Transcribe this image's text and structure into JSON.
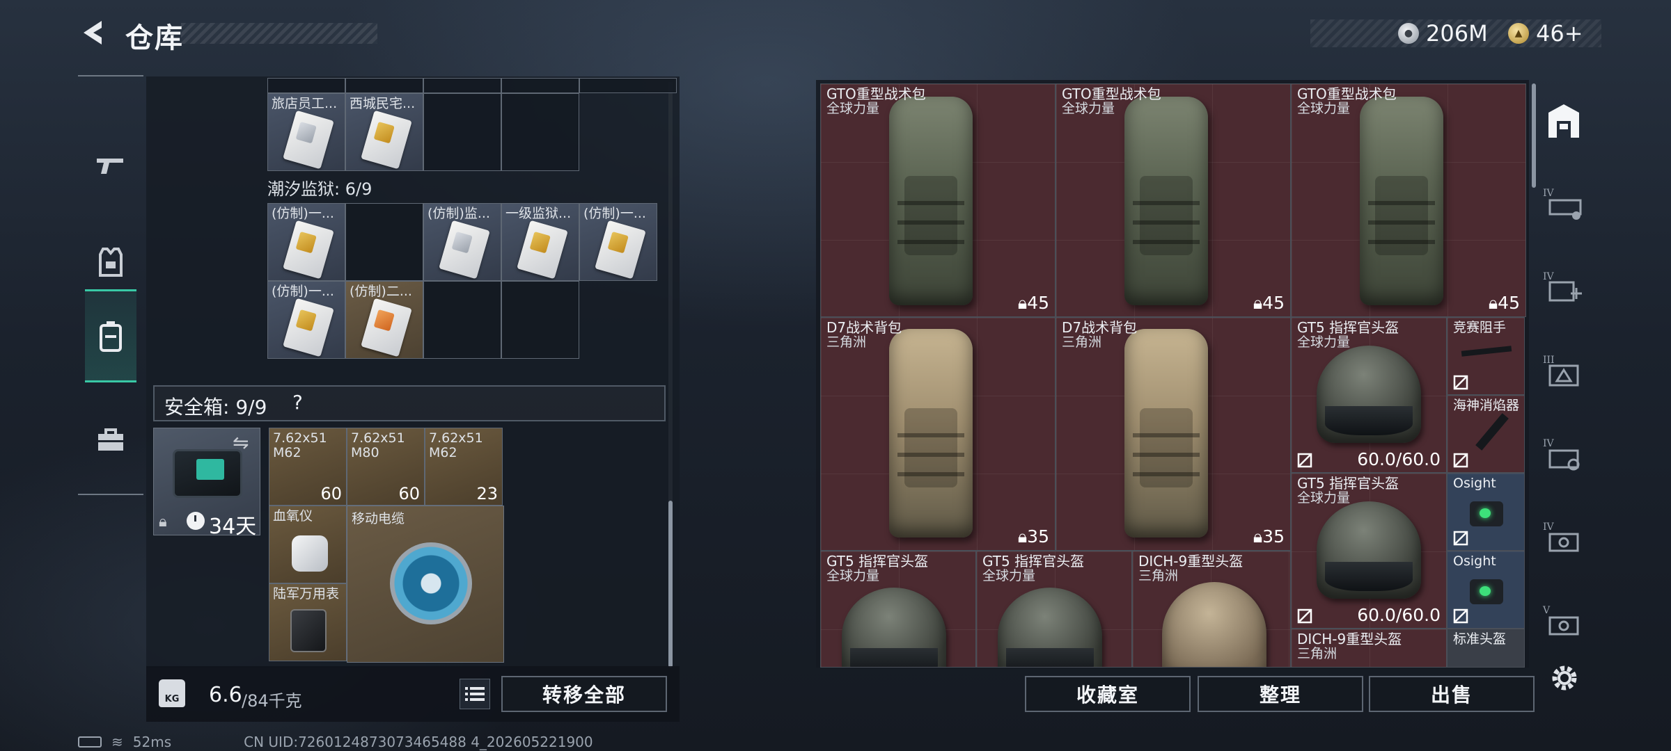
{
  "header": {
    "title": "仓库",
    "currency_silver": "206M",
    "currency_gold": "46+"
  },
  "left_rail": [
    {
      "name": "weapons",
      "icon": "gun-icon"
    },
    {
      "name": "equipment",
      "icon": "vest-icon"
    },
    {
      "name": "backpack",
      "icon": "backpack-icon",
      "active": true
    },
    {
      "name": "toolbox",
      "icon": "toolbox-icon"
    }
  ],
  "collection": {
    "row_top": [
      {
        "name": "旅店员工..."
      },
      {
        "name": "西城民宅..."
      }
    ],
    "prison_label": "潮汐监狱: 6/9",
    "prison_row1": [
      {
        "name": "(仿制)一..."
      },
      {
        "name": ""
      },
      {
        "name": "(仿制)监..."
      },
      {
        "name": "一级监狱..."
      },
      {
        "name": "(仿制)一..."
      }
    ],
    "prison_row2": [
      {
        "name": "(仿制)一..."
      },
      {
        "name": "(仿制)二..."
      }
    ]
  },
  "safebox": {
    "label": "安全箱: 9/9",
    "help": "?",
    "timer": "34天",
    "ammo": [
      {
        "name": "7.62x51",
        "name2": "M62",
        "count": "60"
      },
      {
        "name": "7.62x51",
        "name2": "M80",
        "count": "60"
      },
      {
        "name": "7.62x51",
        "name2": "M62",
        "count": "23"
      }
    ],
    "oximeter": "血氧仪",
    "cable": "移动电缆",
    "multimeter": "陆军万用表"
  },
  "footer": {
    "weight_value": "6.6",
    "weight_max": "/84千克",
    "weight_icon_text": "KG",
    "transfer_all": "转移全部"
  },
  "stash": {
    "items": [
      {
        "name": "GTO重型战术包",
        "source": "全球力量",
        "num": "45"
      },
      {
        "name": "GTO重型战术包",
        "source": "全球力量",
        "num": "45"
      },
      {
        "name": "GTO重型战术包",
        "source": "全球力量",
        "num": "45"
      },
      {
        "name": "D7战术背包",
        "source": "三角洲",
        "num": "35"
      },
      {
        "name": "D7战术背包",
        "source": "三角洲",
        "num": "35"
      },
      {
        "name": "GT5 指挥官头盔",
        "source": "全球力量",
        "num": "60.0/60.0"
      },
      {
        "name": "GT5 指挥官头盔",
        "source": "全球力量",
        "num": "60.0/60.0"
      },
      {
        "name": "竞赛阻手",
        "source": "",
        "num": ""
      },
      {
        "name": "海神消焰器",
        "source": "",
        "num": ""
      },
      {
        "name": "Osight",
        "source": "",
        "num": ""
      },
      {
        "name": "Osight",
        "source": "",
        "num": ""
      },
      {
        "name": "GT5 指挥官头盔",
        "source": "全球力量",
        "num": ""
      },
      {
        "name": "GT5 指挥官头盔",
        "source": "全球力量",
        "num": ""
      },
      {
        "name": "DICH-9重型头盔",
        "source": "三角洲",
        "num": ""
      },
      {
        "name": "DICH-9重型头盔",
        "source": "三角洲",
        "num": ""
      },
      {
        "name": "标准头盔",
        "source": "",
        "num": ""
      }
    ]
  },
  "actions": {
    "collection_room": "收藏室",
    "organize": "整理",
    "sell": "出售"
  },
  "right_rail": [
    {
      "icon": "stash-icon",
      "active": true
    },
    {
      "icon": "tier-iv-vehicle-icon",
      "tier": "IV"
    },
    {
      "icon": "tier-iv-medical-icon",
      "tier": "IV"
    },
    {
      "icon": "tier-iii-warning-icon",
      "tier": "III"
    },
    {
      "icon": "tier-iv-tools-icon",
      "tier": "IV"
    },
    {
      "icon": "tier-iv-chip-icon",
      "tier": "IV"
    },
    {
      "icon": "tier-v-chip-icon",
      "tier": "V"
    }
  ],
  "status": {
    "ping": "52ms",
    "uid": "CN UID:7260124873073465488 4_202605221900"
  },
  "colors": {
    "accent": "#39c9a6",
    "stash_item": "#4b2a30",
    "stash_item_blue": "#334259"
  }
}
